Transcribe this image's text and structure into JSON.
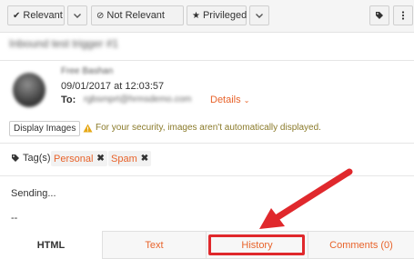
{
  "toolbar": {
    "relevant_label": "Relevant",
    "not_relevant_label": "Not Relevant",
    "privileged_label": "Privileged"
  },
  "email": {
    "subject": "Inbound test trigger #1",
    "from": "Free Bashan",
    "date": "09/01/2017 at 12:03:57",
    "to_label": "To:",
    "to_value": "rgbsmprt@hrmsdemo.com",
    "details_label": "Details"
  },
  "images_notice": {
    "button_label": "Display Images",
    "message": "For your security, images aren't automatically displayed."
  },
  "tags": {
    "label": "Tag(s)",
    "items": [
      "Personal",
      "Spam"
    ]
  },
  "body": {
    "lines": [
      "Sending...",
      "--"
    ]
  },
  "tabs": [
    {
      "label": "HTML",
      "active": true
    },
    {
      "label": "Text",
      "active": false
    },
    {
      "label": "History",
      "active": false
    },
    {
      "label": "Comments (0)",
      "active": false
    }
  ],
  "colors": {
    "accent": "#e8632b",
    "annotation": "#e0282c"
  }
}
